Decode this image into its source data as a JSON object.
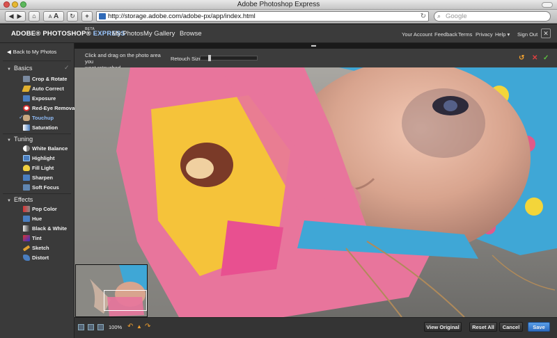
{
  "window": {
    "title": "Adobe Photoshop Express"
  },
  "browser": {
    "url": "http://storage.adobe.com/adobe-px/app/index.html",
    "search_placeholder": "Google",
    "btn_text_small": "A",
    "btn_text_large": "A",
    "add_label": "+"
  },
  "app": {
    "logo_adobe": "ADOBE® PHOTOSHOP®",
    "logo_express": "EXPRESS",
    "logo_beta": "BETA",
    "nav": [
      "My Photos",
      "My Gallery",
      "Browse"
    ],
    "utility": [
      "Your Account",
      "Feedback",
      "Terms",
      "Privacy",
      "Help ▾",
      "Sign Out"
    ]
  },
  "sidebar": {
    "back_label": "Back to My Photos",
    "sections": [
      {
        "title": "Basics",
        "tools": [
          "Crop & Rotate",
          "Auto Correct",
          "Exposure",
          "Red-Eye Removal",
          "Touchup",
          "Saturation"
        ]
      },
      {
        "title": "Tuning",
        "tools": [
          "White Balance",
          "Highlight",
          "Fill Light",
          "Sharpen",
          "Soft Focus"
        ]
      },
      {
        "title": "Effects",
        "tools": [
          "Pop Color",
          "Hue",
          "Black & White",
          "Tint",
          "Sketch",
          "Distort"
        ]
      }
    ],
    "active_tool": "Touchup"
  },
  "options": {
    "hint_line1": "Click and drag on the photo area you",
    "hint_line2": "want retouched.",
    "retouch_label": "Retouch Size:",
    "retouch_size": 0.15
  },
  "bottom": {
    "zoom": "100%",
    "view_original": "View Original",
    "reset_all": "Reset All",
    "cancel": "Cancel",
    "save": "Save"
  },
  "colors": {
    "accent_blue": "#2c6cc0",
    "active_tool": "#8fbcf8",
    "cancel_red": "#e04040",
    "confirm_green": "#5cc040",
    "undo_orange": "#f0a030"
  }
}
